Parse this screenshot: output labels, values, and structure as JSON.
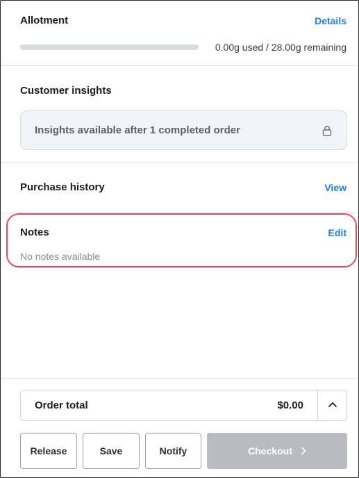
{
  "allotment": {
    "title": "Allotment",
    "details_link": "Details",
    "usage_text": "0.00g used / 28.00g remaining",
    "used_fraction": 0.0
  },
  "insights": {
    "title": "Customer insights",
    "message": "Insights available after 1 completed order",
    "icon": "lock-icon"
  },
  "purchase_history": {
    "title": "Purchase history",
    "view_link": "View"
  },
  "notes": {
    "title": "Notes",
    "edit_link": "Edit",
    "empty_text": "No notes available",
    "highlight_color": "#e04a5c"
  },
  "order": {
    "label": "Order total",
    "amount": "$0.00",
    "toggle_icon": "chevron-up-icon"
  },
  "actions": {
    "release": "Release",
    "save": "Save",
    "notify": "Notify",
    "checkout": "Checkout",
    "checkout_icon": "chevron-right-icon"
  },
  "colors": {
    "link": "#1f7fd6",
    "checkout_disabled": "#b8bbbf"
  }
}
